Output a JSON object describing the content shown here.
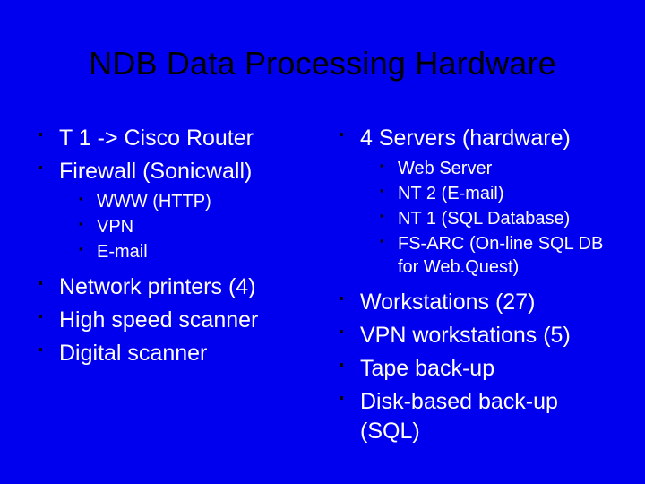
{
  "title": "NDB Data Processing Hardware",
  "left": {
    "items": [
      {
        "text": "T 1 -> Cisco Router"
      },
      {
        "text": "Firewall (Sonicwall)",
        "sub": [
          "WWW (HTTP)",
          "VPN",
          "E-mail"
        ]
      },
      {
        "text": "Network printers (4)"
      },
      {
        "text": "High speed scanner"
      },
      {
        "text": "Digital scanner"
      }
    ]
  },
  "right": {
    "items": [
      {
        "text": "4 Servers (hardware)",
        "sub": [
          "Web Server",
          "NT 2 (E-mail)",
          "NT 1 (SQL Database)",
          "FS-ARC (On-line SQL DB for Web.Quest)"
        ]
      },
      {
        "text": "Workstations (27)"
      },
      {
        "text": "VPN workstations (5)"
      },
      {
        "text": "Tape back-up"
      },
      {
        "text": "Disk-based back-up (SQL)"
      }
    ]
  }
}
